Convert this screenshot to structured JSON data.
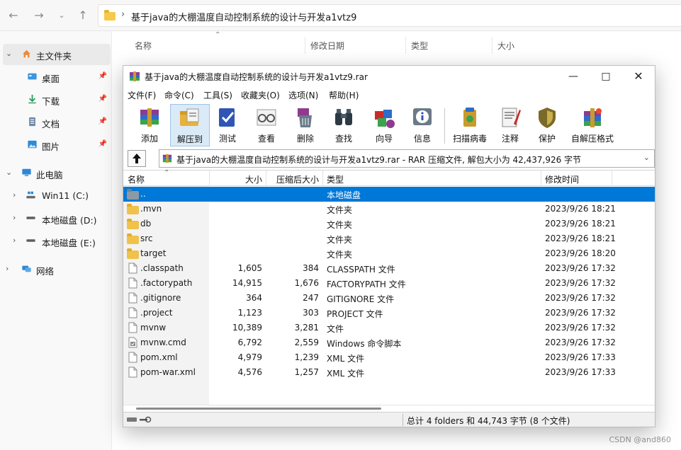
{
  "explorer": {
    "breadcrumb": "基于java的大棚温度自动控制系统的设计与开发a1vtz9",
    "columns": [
      "名称",
      "修改日期",
      "类型",
      "大小"
    ],
    "sidebar": [
      {
        "label": "主文件夹",
        "pinned": false
      },
      {
        "label": "桌面",
        "pinned": true
      },
      {
        "label": "下载",
        "pinned": true
      },
      {
        "label": "文档",
        "pinned": true
      },
      {
        "label": "图片",
        "pinned": true
      },
      {
        "label": "此电脑",
        "pinned": false
      },
      {
        "label": "Win11 (C:)",
        "pinned": false
      },
      {
        "label": "本地磁盘 (D:)",
        "pinned": false
      },
      {
        "label": "本地磁盘 (E:)",
        "pinned": false
      },
      {
        "label": "网络",
        "pinned": false
      }
    ]
  },
  "rar": {
    "title": "基于java的大棚温度自动控制系统的设计与开发a1vtz9.rar",
    "menu": [
      "文件(F)",
      "命令(C)",
      "工具(S)",
      "收藏夹(O)",
      "选项(N)",
      "帮助(H)"
    ],
    "toolbar": [
      "添加",
      "解压到",
      "测试",
      "查看",
      "删除",
      "查找",
      "向导",
      "信息",
      "扫描病毒",
      "注释",
      "保护",
      "自解压格式"
    ],
    "path": "基于java的大棚温度自动控制系统的设计与开发a1vtz9.rar - RAR 压缩文件, 解包大小为 42,437,926 字节",
    "columns": [
      "名称",
      "大小",
      "压缩后大小",
      "类型",
      "修改时间"
    ],
    "rows": [
      {
        "name": "..",
        "size": "",
        "packed": "",
        "type": "本地磁盘",
        "time": "",
        "kind": "up"
      },
      {
        "name": ".mvn",
        "size": "",
        "packed": "",
        "type": "文件夹",
        "time": "2023/9/26 18:21",
        "kind": "folder"
      },
      {
        "name": "db",
        "size": "",
        "packed": "",
        "type": "文件夹",
        "time": "2023/9/26 18:21",
        "kind": "folder"
      },
      {
        "name": "src",
        "size": "",
        "packed": "",
        "type": "文件夹",
        "time": "2023/9/26 18:21",
        "kind": "folder"
      },
      {
        "name": "target",
        "size": "",
        "packed": "",
        "type": "文件夹",
        "time": "2023/9/26 18:20",
        "kind": "folder"
      },
      {
        "name": ".classpath",
        "size": "1,605",
        "packed": "384",
        "type": "CLASSPATH 文件",
        "time": "2023/9/26 17:32",
        "kind": "file"
      },
      {
        "name": ".factorypath",
        "size": "14,915",
        "packed": "1,676",
        "type": "FACTORYPATH 文件",
        "time": "2023/9/26 17:32",
        "kind": "file"
      },
      {
        "name": ".gitignore",
        "size": "364",
        "packed": "247",
        "type": "GITIGNORE 文件",
        "time": "2023/9/26 17:32",
        "kind": "file"
      },
      {
        "name": ".project",
        "size": "1,123",
        "packed": "303",
        "type": "PROJECT 文件",
        "time": "2023/9/26 17:32",
        "kind": "file"
      },
      {
        "name": "mvnw",
        "size": "10,389",
        "packed": "3,281",
        "type": "文件",
        "time": "2023/9/26 17:32",
        "kind": "file"
      },
      {
        "name": "mvnw.cmd",
        "size": "6,792",
        "packed": "2,559",
        "type": "Windows 命令脚本",
        "time": "2023/9/26 17:32",
        "kind": "script"
      },
      {
        "name": "pom.xml",
        "size": "4,979",
        "packed": "1,239",
        "type": "XML 文件",
        "time": "2023/9/26 17:33",
        "kind": "file"
      },
      {
        "name": "pom-war.xml",
        "size": "4,576",
        "packed": "1,257",
        "type": "XML 文件",
        "time": "2023/9/26 17:33",
        "kind": "file"
      }
    ],
    "status": "总计 4 folders 和 44,743 字节 (8 个文件)"
  },
  "watermark": "CSDN @and860",
  "colors": {
    "selection": "#0078d7",
    "folder": "#f0c24b"
  }
}
